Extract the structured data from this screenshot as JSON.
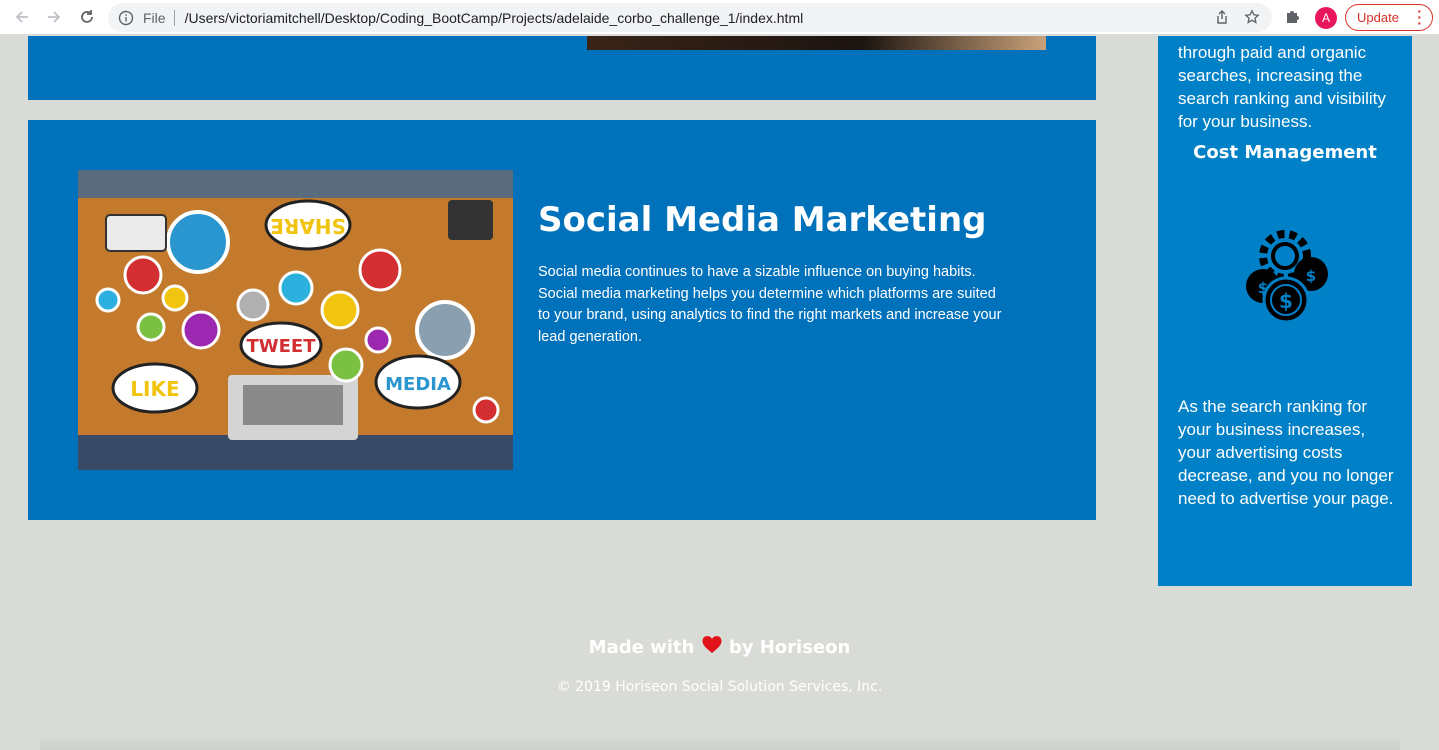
{
  "browser": {
    "file_label": "File",
    "url": "/Users/victoriamitchell/Desktop/Coding_BootCamp/Projects/adelaide_corbo_challenge_1/index.html",
    "avatar_letter": "A",
    "update_label": "Update"
  },
  "card": {
    "title": "Social Media Marketing",
    "text": "Social media continues to have a sizable influence on buying habits. Social media marketing helps you determine which platforms are suited to your brand, using analytics to find the right markets and increase your lead generation.",
    "image_words": [
      "SHARE",
      "TWEET",
      "LIKE",
      "MEDIA"
    ]
  },
  "aside": {
    "top_text": "through paid and organic searches, increasing the search ranking and visibility for your business.",
    "heading": "Cost Management",
    "text": "As the search ranking for your business increases, your advertising costs decrease, and you no longer need to advertise your page."
  },
  "footer": {
    "made_with": "Made with",
    "by": "by Horiseon",
    "copyright": "© 2019 Horiseon Social Solution Services, Inc."
  },
  "colors": {
    "page_bg": "#d9dcd6",
    "card_bg": "#0072bb",
    "aside_bg": "#0080c6",
    "update_red": "#d93025"
  }
}
